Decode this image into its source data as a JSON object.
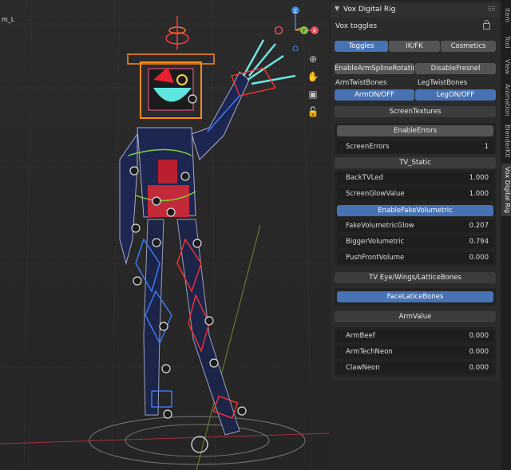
{
  "viewport": {
    "corner_label": "m_L",
    "gizmo": {
      "z": "Z",
      "y": "Y",
      "x": "X"
    },
    "nav_icons": [
      "zoom-icon",
      "hand-icon",
      "camera-icon",
      "lock-icon"
    ]
  },
  "side_tabs": [
    "Item",
    "Tool",
    "View",
    "Animation",
    "BlenderKit",
    "Vox Digital Rig"
  ],
  "panel": {
    "title": "Vox Digital Rig",
    "subtitle": "Vox toggles",
    "tabs": [
      "Toggles",
      "IK/FK",
      "Cosmetics"
    ],
    "buttons": {
      "enable_arm_spline": "EnableArmSplineRotation",
      "disable_fresnel": "DisableFresnel",
      "arm_on_off": "ArmON/OFF",
      "leg_on_off": "LegON/OFF",
      "screen_textures": "ScreenTextures",
      "enable_errors": "EnableErrors",
      "tv_static": "TV_Static",
      "enable_fake_volumetric": "EnableFakeVolumetric",
      "tv_eye_wings": "TV Eye/Wings/LatticeBones",
      "face_latice_bones": "FaceLaticeBones",
      "arm_value": "ArmValue"
    },
    "labels": {
      "arm_twist": "ArmTwistBones",
      "leg_twist": "LegTwistBones"
    },
    "fields": {
      "screen_errors": {
        "label": "ScreenErrors",
        "value": "1"
      },
      "back_tv_led": {
        "label": "BackTVLed",
        "value": "1.000"
      },
      "screen_glow": {
        "label": "ScreenGlowValue",
        "value": "1.000"
      },
      "fake_vol_glow": {
        "label": "FakeVolumetricGlow",
        "value": "0.207"
      },
      "bigger_vol": {
        "label": "BiggerVolumetric",
        "value": "0.794"
      },
      "push_front": {
        "label": "PushFrontVolume",
        "value": "0.000"
      },
      "arm_beef": {
        "label": "ArmBeef",
        "value": "0.000"
      },
      "arm_tech_neon": {
        "label": "ArmTechNeon",
        "value": "0.000"
      },
      "claw_neon": {
        "label": "ClawNeon",
        "value": "0.000"
      }
    }
  },
  "colors": {
    "accent": "#4772b3",
    "axis_x": "#e84a5f",
    "axis_y": "#8bc34a",
    "axis_z": "#3f83d8"
  }
}
